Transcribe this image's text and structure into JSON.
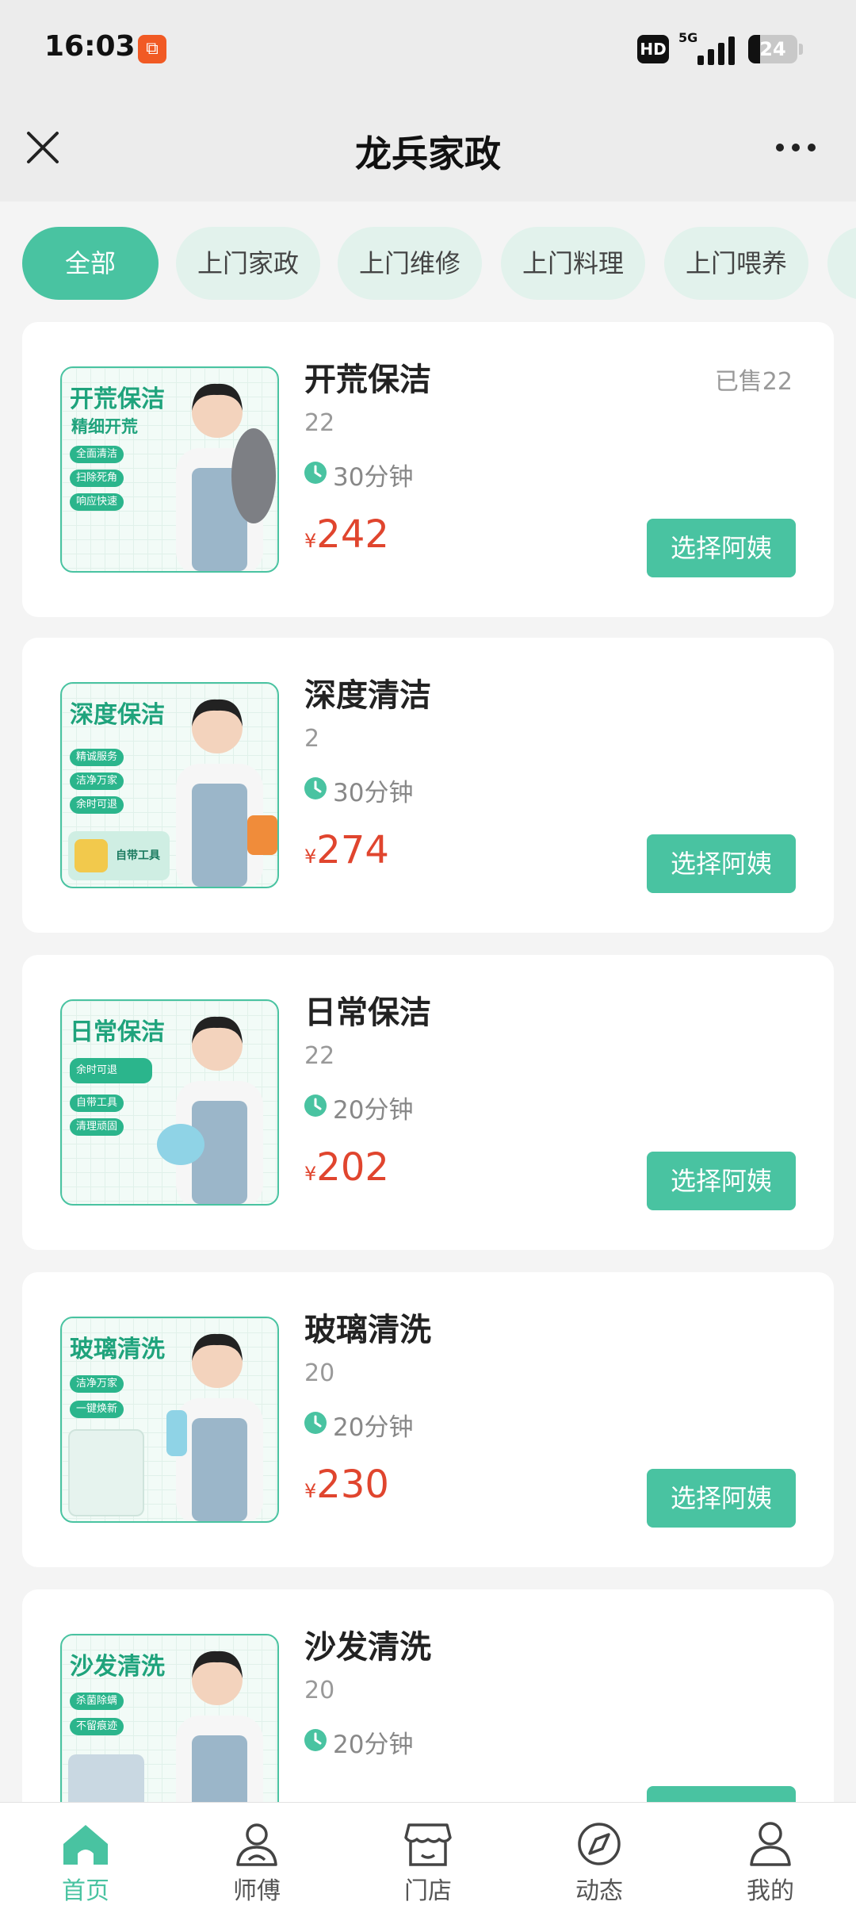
{
  "status_bar": {
    "time": "16:03",
    "network": "5G",
    "hd": "HD",
    "battery": "24"
  },
  "header": {
    "title": "龙兵家政"
  },
  "tabs": [
    {
      "label": "全部",
      "active": true
    },
    {
      "label": "上门家政",
      "active": false
    },
    {
      "label": "上门维修",
      "active": false
    },
    {
      "label": "上门料理",
      "active": false
    },
    {
      "label": "上门喂养",
      "active": false
    }
  ],
  "services": [
    {
      "name": "开荒保洁",
      "count": "22",
      "sold": "已售22",
      "duration": "30分钟",
      "currency": "¥",
      "price": "242",
      "button": "选择阿姨",
      "image": {
        "title": "开荒保洁",
        "subtitle": "精细开荒",
        "tags": [
          "全面清洁",
          "扫除死角",
          "响应快速"
        ],
        "extra": ""
      }
    },
    {
      "name": "深度清洁",
      "count": "2",
      "sold": "",
      "duration": "30分钟",
      "currency": "¥",
      "price": "274",
      "button": "选择阿姨",
      "image": {
        "title": "深度保洁",
        "subtitle": "",
        "tags": [
          "精诚服务",
          "洁净万家",
          "余时可退"
        ],
        "extra": "自带工具"
      }
    },
    {
      "name": "日常保洁",
      "count": "22",
      "sold": "",
      "duration": "20分钟",
      "currency": "¥",
      "price": "202",
      "button": "选择阿姨",
      "image": {
        "title": "日常保洁",
        "subtitle": "",
        "tags": [
          "余时可退",
          "自带工具",
          "清理顽固"
        ],
        "extra": ""
      }
    },
    {
      "name": "玻璃清洗",
      "count": "20",
      "sold": "",
      "duration": "20分钟",
      "currency": "¥",
      "price": "230",
      "button": "选择阿姨",
      "image": {
        "title": "玻璃清洗",
        "subtitle": "",
        "tags": [
          "洁净万家",
          "一键焕新"
        ],
        "extra": ""
      }
    },
    {
      "name": "沙发清洗",
      "count": "20",
      "sold": "",
      "duration": "20分钟",
      "currency": "¥",
      "price": "",
      "button": "",
      "image": {
        "title": "沙发清洗",
        "subtitle": "",
        "tags": [
          "杀菌除螨",
          "不留痕迹"
        ],
        "extra": ""
      }
    }
  ],
  "bottom_nav": [
    {
      "label": "首页",
      "icon": "home-icon",
      "active": true
    },
    {
      "label": "师傅",
      "icon": "worker-icon",
      "active": false
    },
    {
      "label": "门店",
      "icon": "store-icon",
      "active": false
    },
    {
      "label": "动态",
      "icon": "compass-icon",
      "active": false
    },
    {
      "label": "我的",
      "icon": "profile-icon",
      "active": false
    }
  ],
  "colors": {
    "accent": "#49c3a1",
    "price": "#e0452e",
    "tab_bg": "#e2f2ec"
  }
}
